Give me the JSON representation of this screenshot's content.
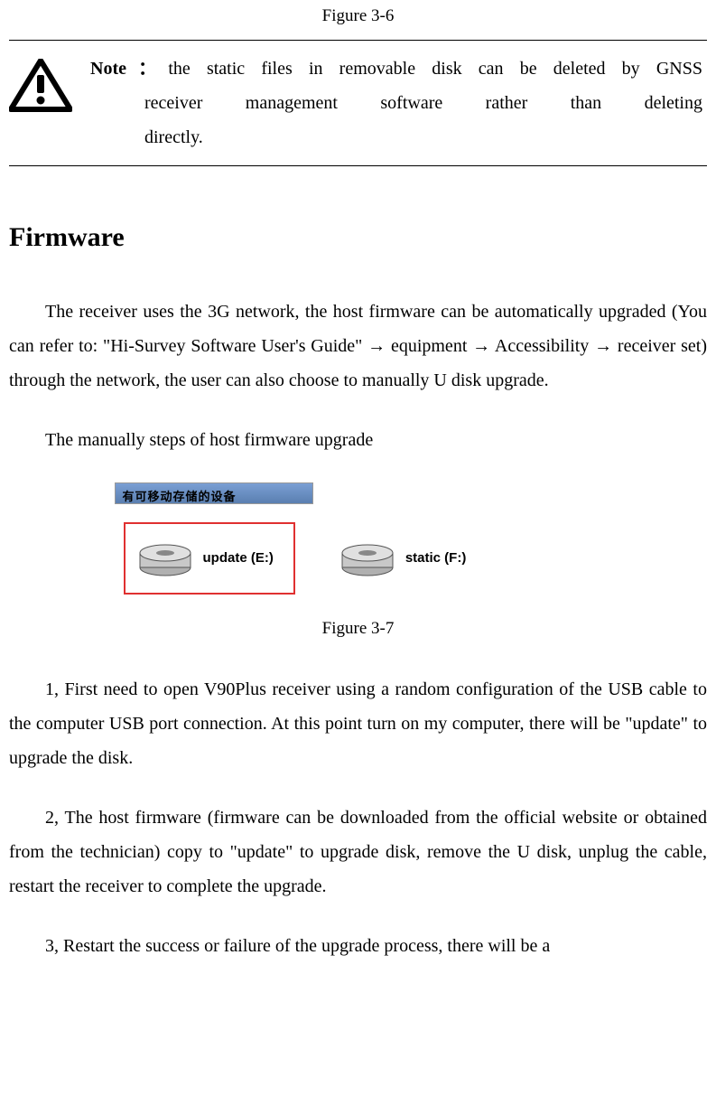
{
  "figure_top_caption": "Figure 3-6",
  "note": {
    "label": "Note：",
    "line1": "the static files in removable disk can be deleted by GNSS",
    "line2": "receiver management software rather than deleting",
    "line3": "directly."
  },
  "section_title": "Firmware",
  "paragraph1": "The receiver uses the 3G network, the host firmware can be automatically upgraded (You can refer to: \"Hi-Survey Software User's Guide\" → equipment → Accessibility → receiver set) through the network, the user can also choose to manually U disk upgrade.",
  "paragraph2": "The manually steps of host firmware upgrade",
  "drives": {
    "header": "有可移动存储的设备",
    "update_label": "update (E:)",
    "static_label": "static (F:)"
  },
  "figure_mid_caption": "Figure 3-7",
  "paragraph3": "1, First need to open V90Plus receiver using a random configuration of the USB cable to the computer USB port connection. At this point turn on my computer, there will be \"update\" to upgrade the disk.",
  "paragraph4": "2, The host firmware (firmware can be downloaded from the official website or obtained from the technician) copy to \"update\" to upgrade disk, remove the U disk, unplug the cable, restart the receiver to complete the upgrade.",
  "paragraph5": "3, Restart the success or failure of the upgrade process, there will be a"
}
